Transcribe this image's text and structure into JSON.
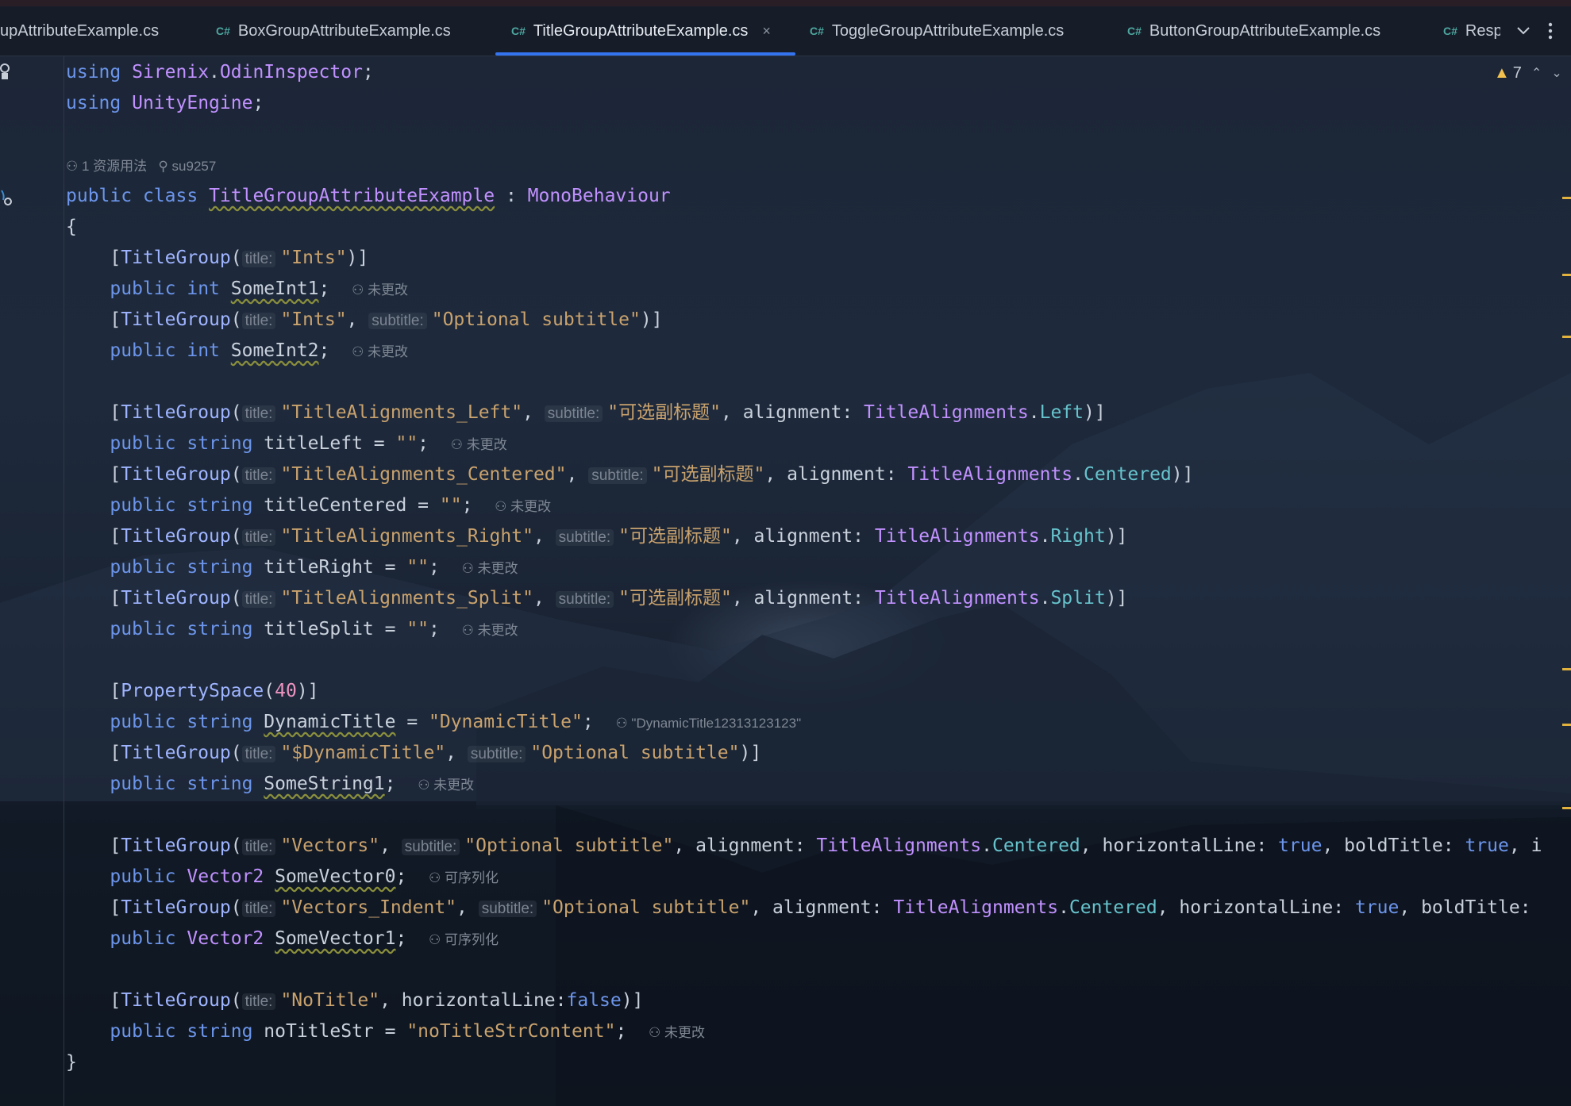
{
  "tabs": [
    {
      "label": "upAttributeExample.cs",
      "cs": false
    },
    {
      "label": "BoxGroupAttributeExample.cs",
      "cs": true
    },
    {
      "label": "TitleGroupAttributeExample.cs",
      "cs": true,
      "active": true
    },
    {
      "label": "ToggleGroupAttributeExample.cs",
      "cs": true
    },
    {
      "label": "ButtonGroupAttributeExample.cs",
      "cs": true
    },
    {
      "label": "Resp",
      "cs": true
    }
  ],
  "tab_cs_badge": "C#",
  "tab_close": "×",
  "inspection": {
    "count": "7"
  },
  "meta": {
    "usages": "1 资源用法",
    "author": "su9257"
  },
  "code": {
    "l1_kw": "using",
    "l1_ns1": "Sirenix",
    "l1_dot": ".",
    "l1_ns2": "OdinInspector",
    "l1_semi": ";",
    "l2_kw": "using",
    "l2_ns": "UnityEngine",
    "l2_semi": ";",
    "cls_public": "public",
    "cls_class": "class",
    "cls_name": "TitleGroupAttributeExample",
    "cls_colon": " : ",
    "cls_base": "MonoBehaviour",
    "brace_open": "{",
    "brace_close": "}",
    "tg": "TitleGroup",
    "title_hint": "title:",
    "subtitle_hint": "subtitle:",
    "s_ints": "\"Ints\"",
    "s_optsub": "\"Optional subtitle\"",
    "public": "public",
    "int": "int",
    "string": "string",
    "vec2": "Vector2",
    "f_someint1": "SomeInt1",
    "f_someint2": "SomeInt2",
    "unchanged": "未更改",
    "serializable": "可序列化",
    "s_left": "\"TitleAlignments_Left\"",
    "s_centered": "\"TitleAlignments_Centered\"",
    "s_right": "\"TitleAlignments_Right\"",
    "s_split": "\"TitleAlignments_Split\"",
    "s_cn_sub": "\"可选副标题\"",
    "alignment": "alignment",
    "ta": "TitleAlignments",
    "e_left": "Left",
    "e_centered": "Centered",
    "e_right": "Right",
    "e_split": "Split",
    "f_titleleft": "titleLeft",
    "f_titlecentered": "titleCentered",
    "f_titleright": "titleRight",
    "f_titlesplit": "titleSplit",
    "empty_str": "\"\"",
    "propspace": "PropertySpace",
    "n40": "40",
    "f_dynamic": "DynamicTitle",
    "s_dynamic": "\"DynamicTitle\"",
    "dyn_hint": "\"DynamicTitle12313123123\"",
    "s_dollar": "\"$DynamicTitle\"",
    "f_somestring1": "SomeString1",
    "s_vectors": "\"Vectors\"",
    "s_vectors_indent": "\"Vectors_Indent\"",
    "horizontalLine": "horizontalLine",
    "boldTitle": "boldTitle",
    "true": "true",
    "false": "false",
    "f_somevec0": "SomeVector0",
    "f_somevec1": "SomeVector1",
    "s_notitle": "\"NoTitle\"",
    "f_notitlestr": "noTitleStr",
    "s_notitlecontent": "\"noTitleStrContent\"",
    "trail_i": "i",
    "trail_colon": ": "
  }
}
